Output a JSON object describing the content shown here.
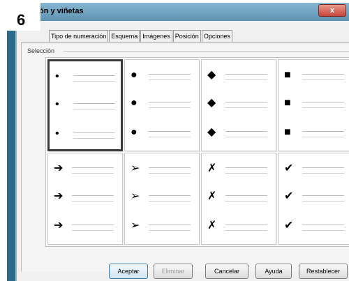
{
  "step_number": "6",
  "window": {
    "title": "ón y viñetas",
    "close_label": "x"
  },
  "tabs": [
    {
      "label": "Tipo de numeración"
    },
    {
      "label": "Esquema"
    },
    {
      "label": "Imágenes"
    },
    {
      "label": "Posición"
    },
    {
      "label": "Opciones"
    }
  ],
  "selection_label": "Selección",
  "bullet_styles": [
    {
      "symbol": "•",
      "icon": "small-dot-bullet-icon",
      "selected": true
    },
    {
      "symbol": "●",
      "icon": "large-dot-bullet-icon",
      "selected": false
    },
    {
      "symbol": "◆",
      "icon": "diamond-bullet-icon",
      "selected": false
    },
    {
      "symbol": "■",
      "icon": "square-bullet-icon",
      "selected": false
    },
    {
      "symbol": "➔",
      "icon": "arrow-bullet-icon",
      "selected": false
    },
    {
      "symbol": "➢",
      "icon": "arrowhead-bullet-icon",
      "selected": false
    },
    {
      "symbol": "✗",
      "icon": "x-mark-bullet-icon",
      "selected": false
    },
    {
      "symbol": "✔",
      "icon": "checkmark-bullet-icon",
      "selected": false
    }
  ],
  "buttons": {
    "accept": "Aceptar",
    "delete": "Eliminar",
    "cancel": "Cancelar",
    "help": "Ayuda",
    "reset": "Restablecer"
  }
}
